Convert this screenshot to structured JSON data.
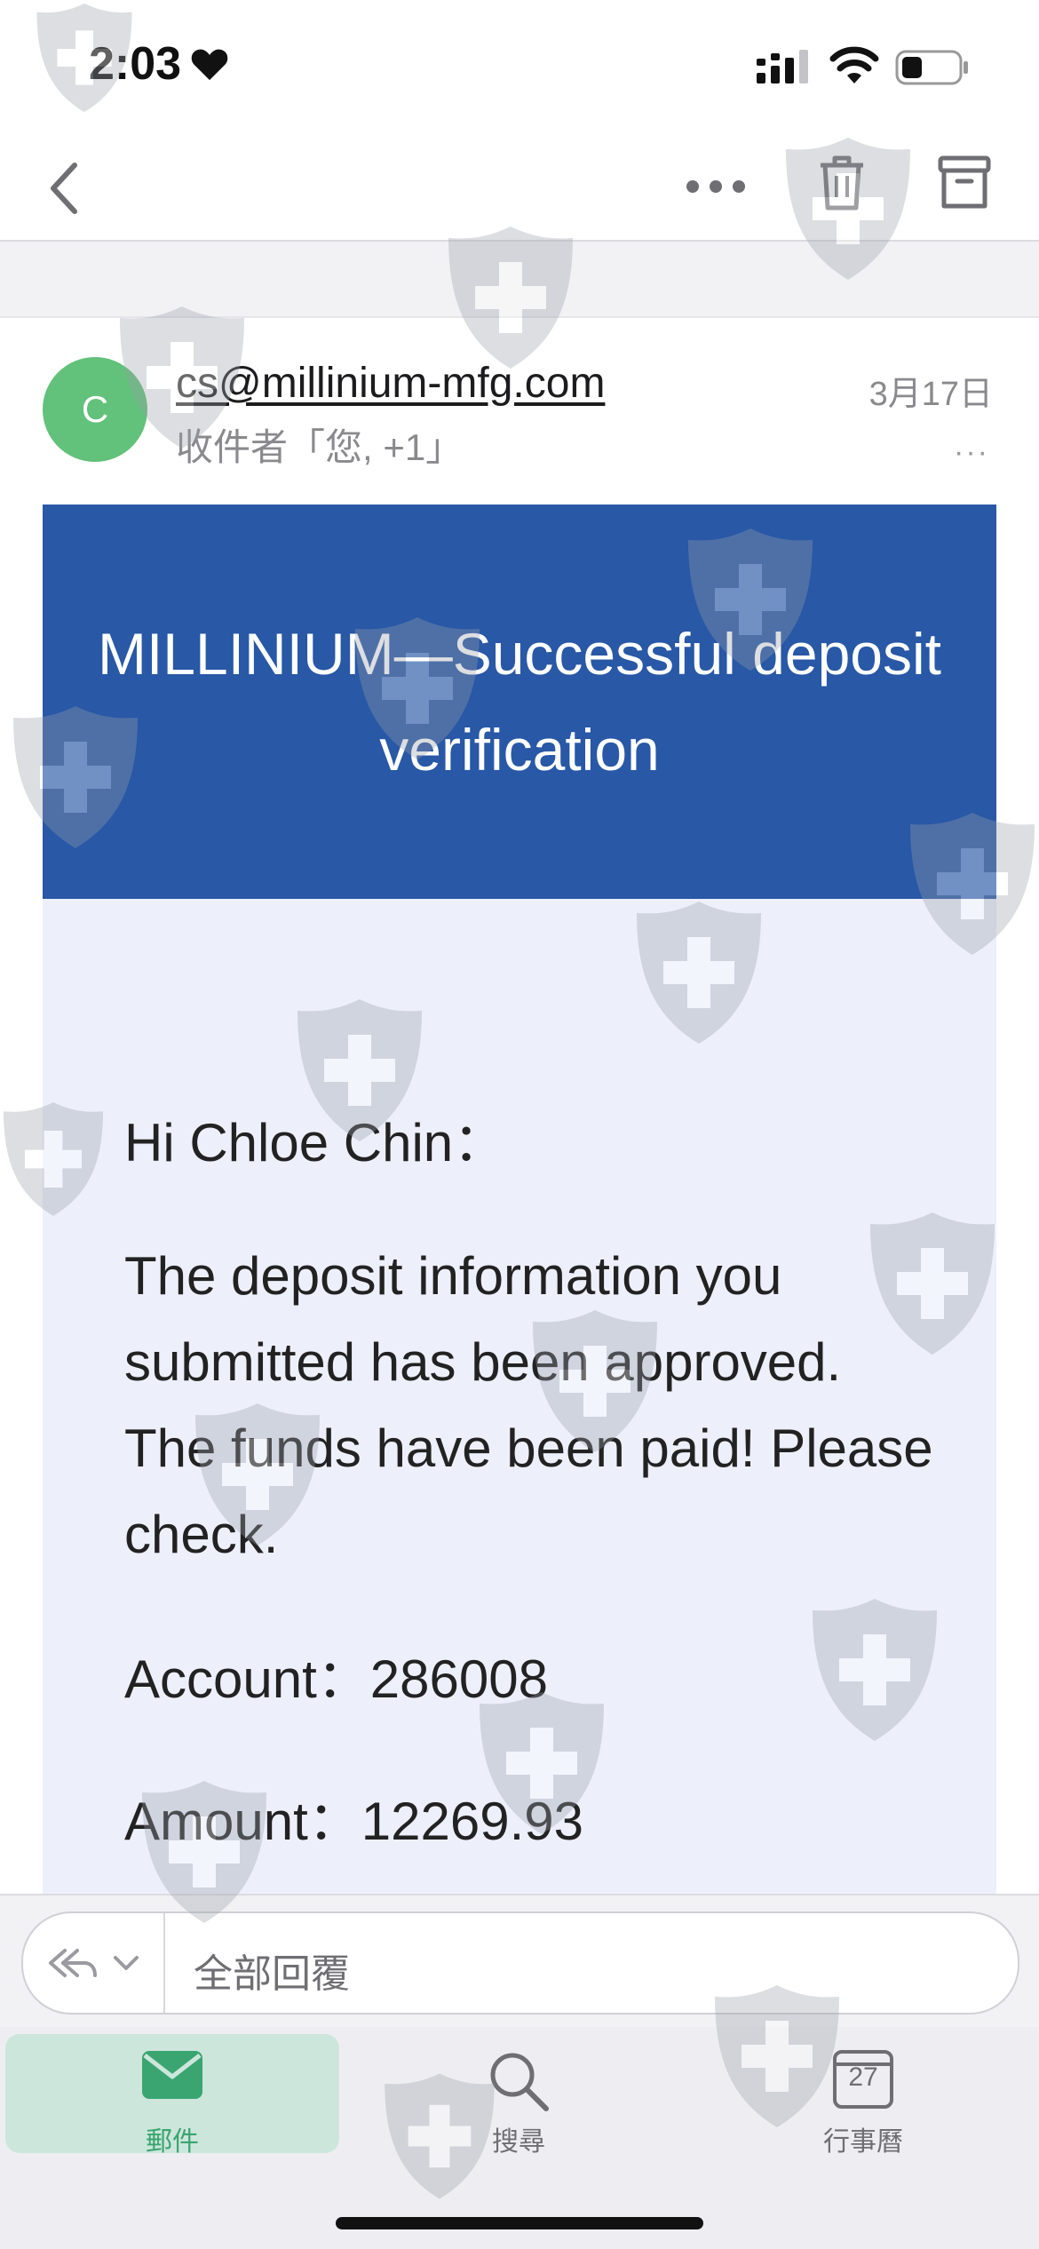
{
  "status_bar": {
    "time": "2:03"
  },
  "email": {
    "avatar_initial": "C",
    "sender": "cs@millinium-mfg.com",
    "recipients": "收件者「您, +1」",
    "date": "3月17日",
    "more": "···"
  },
  "body": {
    "banner_title": "MILLINIUM—Successful deposit verification",
    "greeting": "Hi Chloe Chin：",
    "message": "The deposit information you submitted has been approved. The funds have been paid! Please check.",
    "account": "Account：286008",
    "amount": "Amount：12269.93"
  },
  "reply_bar": {
    "label": "全部回覆"
  },
  "tab_bar": {
    "mail": "郵件",
    "search": "搜尋",
    "calendar": "行事曆",
    "calendar_day": "27"
  },
  "colors": {
    "banner": "#2858a6",
    "content_bg": "#edf0fb",
    "avatar": "#62c17a",
    "accent_green": "#3aa570"
  }
}
